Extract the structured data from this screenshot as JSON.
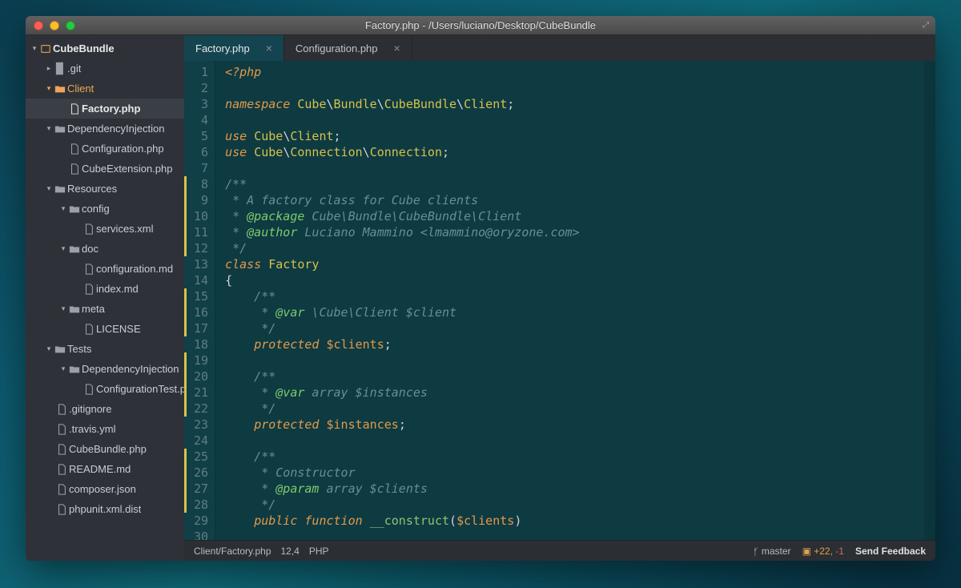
{
  "window": {
    "title": "Factory.php - /Users/luciano/Desktop/CubeBundle"
  },
  "sidebar": {
    "project_name": "CubeBundle",
    "items": {
      "git": ".git",
      "client": "Client",
      "factory": "Factory.php",
      "di": "DependencyInjection",
      "config_php": "Configuration.php",
      "cubeext": "CubeExtension.php",
      "resources": "Resources",
      "config": "config",
      "services": "services.xml",
      "doc": "doc",
      "conf_md": "configuration.md",
      "index_md": "index.md",
      "meta": "meta",
      "license": "LICENSE",
      "tests": "Tests",
      "di2": "DependencyInjection",
      "conftest": "ConfigurationTest.php",
      "gitignore": ".gitignore",
      "travis": ".travis.yml",
      "cubebundle": "CubeBundle.php",
      "readme": "README.md",
      "composer": "composer.json",
      "phpunit": "phpunit.xml.dist"
    }
  },
  "tabs": [
    {
      "label": "Factory.php",
      "active": true
    },
    {
      "label": "Configuration.php",
      "active": false
    }
  ],
  "code": {
    "lines": [
      {
        "n": 1,
        "seg": [
          [
            "k",
            "<?php"
          ]
        ]
      },
      {
        "n": 2,
        "seg": []
      },
      {
        "n": 3,
        "seg": [
          [
            "k",
            "namespace"
          ],
          [
            "p",
            " "
          ],
          [
            "ns",
            "Cube"
          ],
          [
            "p",
            "\\"
          ],
          [
            "ns",
            "Bundle"
          ],
          [
            "p",
            "\\"
          ],
          [
            "ns",
            "CubeBundle"
          ],
          [
            "p",
            "\\"
          ],
          [
            "ns",
            "Client"
          ],
          [
            "p",
            ";"
          ]
        ]
      },
      {
        "n": 4,
        "seg": []
      },
      {
        "n": 5,
        "seg": [
          [
            "k",
            "use"
          ],
          [
            "p",
            " "
          ],
          [
            "ns",
            "Cube"
          ],
          [
            "p",
            "\\"
          ],
          [
            "ns",
            "Client"
          ],
          [
            "p",
            ";"
          ]
        ]
      },
      {
        "n": 6,
        "seg": [
          [
            "k",
            "use"
          ],
          [
            "p",
            " "
          ],
          [
            "ns",
            "Cube"
          ],
          [
            "p",
            "\\"
          ],
          [
            "ns",
            "Connection"
          ],
          [
            "p",
            "\\"
          ],
          [
            "ns",
            "Connection"
          ],
          [
            "p",
            ";"
          ]
        ]
      },
      {
        "n": 7,
        "seg": []
      },
      {
        "n": 8,
        "mod": true,
        "seg": [
          [
            "cm",
            "/**"
          ]
        ]
      },
      {
        "n": 9,
        "mod": true,
        "seg": [
          [
            "cm",
            " * A factory class for Cube clients"
          ]
        ]
      },
      {
        "n": 10,
        "mod": true,
        "seg": [
          [
            "cm",
            " * "
          ],
          [
            "tag",
            "@package"
          ],
          [
            "cm",
            " Cube\\Bundle\\CubeBundle\\Client"
          ]
        ]
      },
      {
        "n": 11,
        "mod": true,
        "seg": [
          [
            "cm",
            " * "
          ],
          [
            "tag",
            "@author"
          ],
          [
            "cm",
            " Luciano Mammino <lmammino@oryzone.com>"
          ]
        ]
      },
      {
        "n": 12,
        "mod": true,
        "seg": [
          [
            "cm",
            " */"
          ]
        ]
      },
      {
        "n": 13,
        "seg": [
          [
            "k",
            "class"
          ],
          [
            "p",
            " "
          ],
          [
            "ns",
            "Factory"
          ]
        ]
      },
      {
        "n": 14,
        "seg": [
          [
            "p",
            "{"
          ]
        ]
      },
      {
        "n": 15,
        "mod": true,
        "seg": [
          [
            "cm",
            "    /**"
          ]
        ]
      },
      {
        "n": 16,
        "mod": true,
        "seg": [
          [
            "cm",
            "     * "
          ],
          [
            "tag",
            "@var"
          ],
          [
            "cm",
            " \\Cube\\Client $client"
          ]
        ]
      },
      {
        "n": 17,
        "mod": true,
        "seg": [
          [
            "cm",
            "     */"
          ]
        ]
      },
      {
        "n": 18,
        "seg": [
          [
            "p",
            "    "
          ],
          [
            "k",
            "protected"
          ],
          [
            "p",
            " "
          ],
          [
            "var",
            "$clients"
          ],
          [
            "p",
            ";"
          ]
        ]
      },
      {
        "n": 19,
        "mod": true,
        "seg": []
      },
      {
        "n": 20,
        "mod": true,
        "seg": [
          [
            "cm",
            "    /**"
          ]
        ]
      },
      {
        "n": 21,
        "mod": true,
        "seg": [
          [
            "cm",
            "     * "
          ],
          [
            "tag",
            "@var"
          ],
          [
            "cm",
            " array $instances"
          ]
        ]
      },
      {
        "n": 22,
        "mod": true,
        "seg": [
          [
            "cm",
            "     */"
          ]
        ]
      },
      {
        "n": 23,
        "seg": [
          [
            "p",
            "    "
          ],
          [
            "k",
            "protected"
          ],
          [
            "p",
            " "
          ],
          [
            "var",
            "$instances"
          ],
          [
            "p",
            ";"
          ]
        ]
      },
      {
        "n": 24,
        "seg": []
      },
      {
        "n": 25,
        "mod": true,
        "seg": [
          [
            "cm",
            "    /**"
          ]
        ]
      },
      {
        "n": 26,
        "mod": true,
        "seg": [
          [
            "cm",
            "     * Constructor"
          ]
        ]
      },
      {
        "n": 27,
        "mod": true,
        "seg": [
          [
            "cm",
            "     * "
          ],
          [
            "tag",
            "@param"
          ],
          [
            "cm",
            " array $clients"
          ]
        ]
      },
      {
        "n": 28,
        "mod": true,
        "seg": [
          [
            "cm",
            "     */"
          ]
        ]
      },
      {
        "n": 29,
        "seg": [
          [
            "p",
            "    "
          ],
          [
            "k",
            "public"
          ],
          [
            "p",
            " "
          ],
          [
            "k",
            "function"
          ],
          [
            "p",
            " "
          ],
          [
            "fn",
            "__construct"
          ],
          [
            "p",
            "("
          ],
          [
            "var",
            "$clients"
          ],
          [
            "p",
            ")"
          ]
        ]
      },
      {
        "n": 30,
        "seg": [
          [
            "p",
            "    "
          ]
        ]
      }
    ]
  },
  "status": {
    "path": "Client/Factory.php",
    "pos": "12,4",
    "lang": "PHP",
    "branch": "master",
    "git_add": "+22,",
    "git_del": " -1",
    "feedback": "Send Feedback"
  }
}
